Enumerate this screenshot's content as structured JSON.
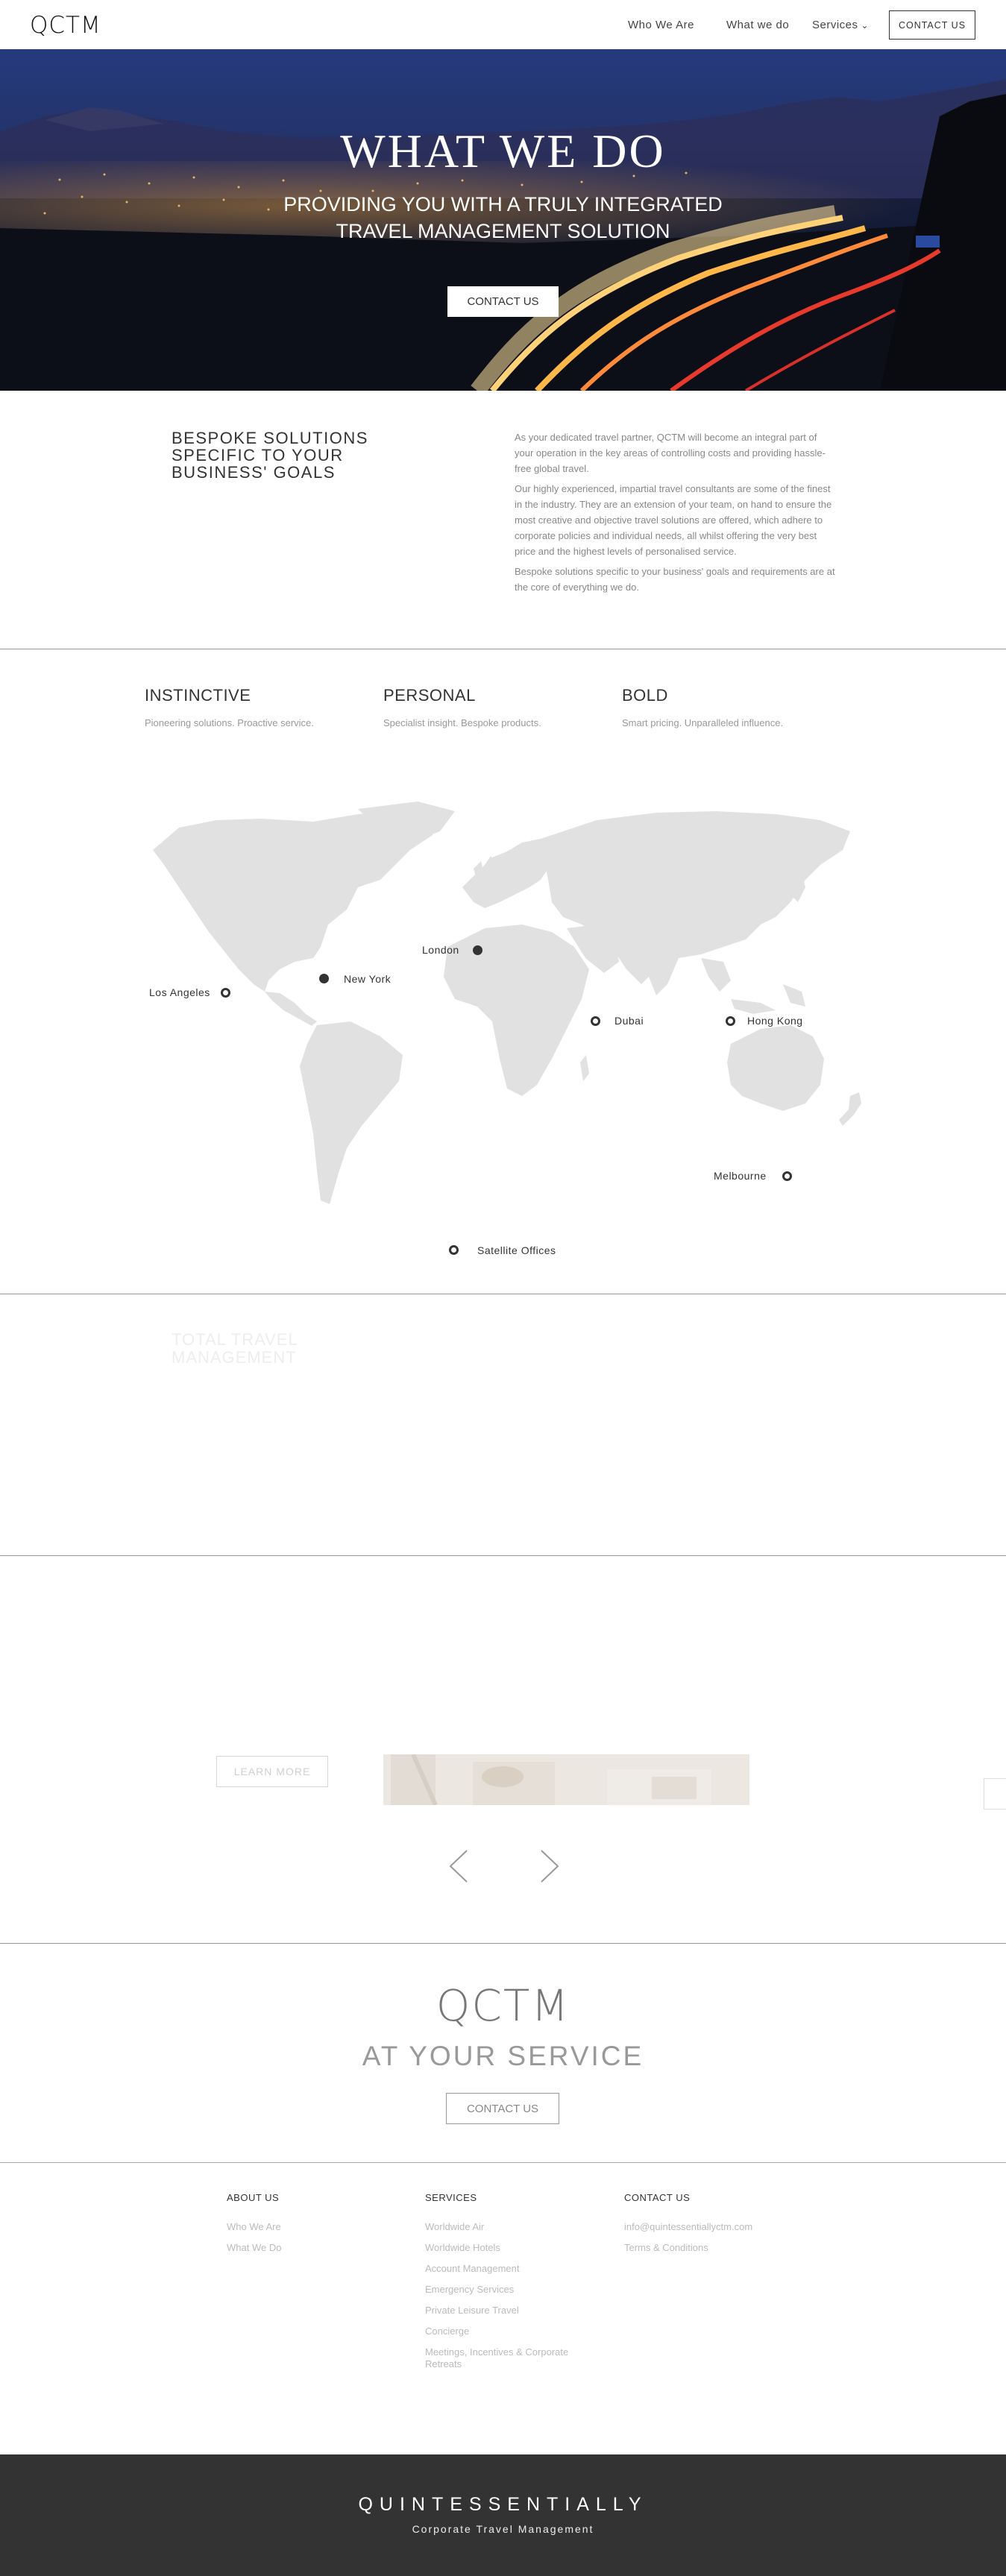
{
  "nav": {
    "logo": "QCTM",
    "links": [
      "Who We Are",
      "What we do",
      "Services"
    ],
    "contact": "CONTACT US"
  },
  "hero": {
    "title": "WHAT WE DO",
    "subtitle_line1": "PROVIDING YOU WITH A TRULY INTEGRATED",
    "subtitle_line2": "TRAVEL MANAGEMENT SOLUTION",
    "button": "CONTACT US"
  },
  "bespoke": {
    "title": "BESPOKE SOLUTIONS SPECIFIC TO YOUR BUSINESS' GOALS",
    "paragraphs": [
      "As your dedicated travel partner, QCTM will become an integral part of your operation in the key areas of controlling costs and providing hassle-free global travel.",
      "Our highly experienced, impartial travel consultants are some of the finest in the industry. They are an extension of your team, on hand to ensure the most creative and objective travel solutions are offered, which adhere to corporate policies and individual needs, all whilst offering the very best price and the highest levels of personalised service.",
      "Bespoke solutions specific to your business' goals and requirements are at the core of everything we do."
    ]
  },
  "pillars": [
    {
      "title": "INSTINCTIVE",
      "text": "Pioneering solutions. Proactive service."
    },
    {
      "title": "PERSONAL",
      "text": "Specialist insight. Bespoke products."
    },
    {
      "title": "BOLD",
      "text": "Smart pricing. Unparalleled influence."
    }
  ],
  "map": {
    "cities": [
      "London",
      "New York",
      "Los Angeles",
      "Dubai",
      "Hong Kong",
      "Melbourne"
    ],
    "legend": "Satellite Offices"
  },
  "total_travel": {
    "line1": "TOTAL TRAVEL",
    "line2": "MANAGEMENT"
  },
  "slider": {
    "learn_more": "LEARN MORE"
  },
  "cta": {
    "logo": "QCTM",
    "subtitle": "AT YOUR SERVICE",
    "button": "CONTACT US"
  },
  "footer": {
    "about": {
      "heading": "ABOUT US",
      "links": [
        "Who We Are",
        "What We Do"
      ]
    },
    "services": {
      "heading": "SERVICES",
      "links": [
        "Worldwide Air",
        "Worldwide Hotels",
        "Account Management",
        "Emergency Services",
        "Private Leisure Travel",
        "Concierge",
        "Meetings, Incentives & Corporate Retreats"
      ]
    },
    "contact": {
      "heading": "CONTACT US",
      "links": [
        "info@quintessentiallyctm.com",
        "Terms & Conditions"
      ]
    }
  },
  "bottom": {
    "brand": "QUINTESSENTIALLY",
    "sub": "Corporate Travel Management"
  }
}
